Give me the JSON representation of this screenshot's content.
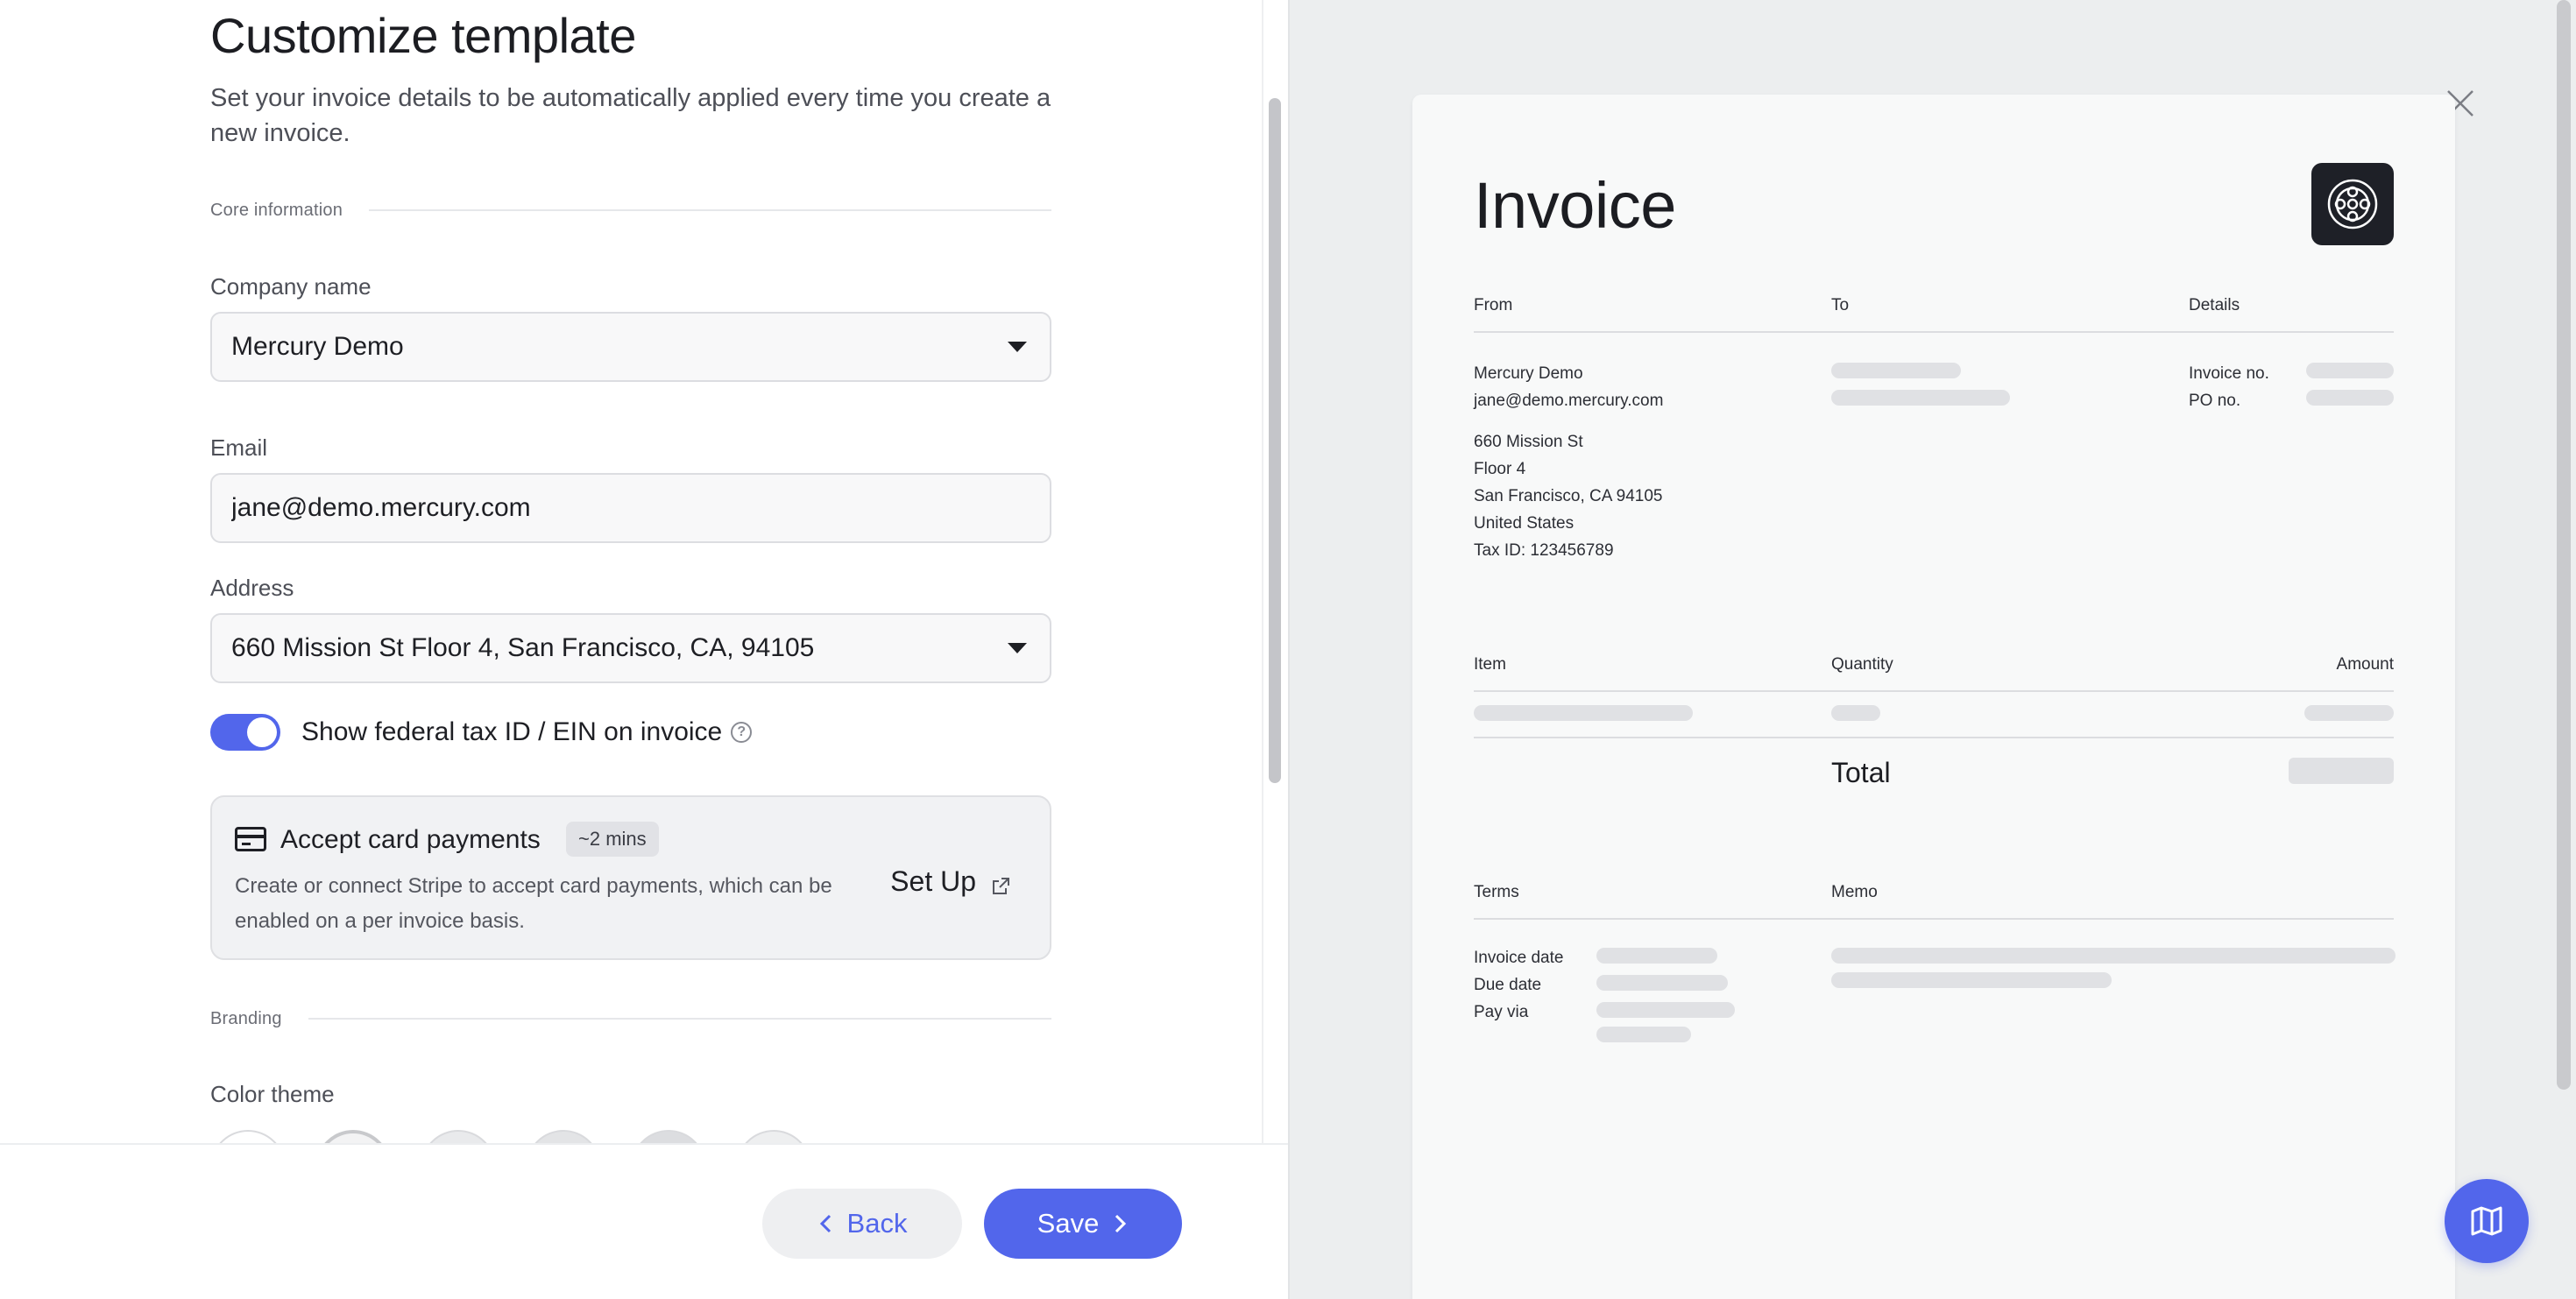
{
  "page": {
    "title": "Customize template",
    "description": "Set your invoice details to be automatically applied every time you create a new invoice."
  },
  "sections": {
    "core": "Core information",
    "branding": "Branding"
  },
  "fields": {
    "company_label": "Company name",
    "company_value": "Mercury Demo",
    "email_label": "Email",
    "email_value": "jane@demo.mercury.com",
    "address_label": "Address",
    "address_value": "660 Mission St Floor 4, San Francisco, CA, 94105"
  },
  "toggle": {
    "label": "Show federal tax ID / EIN on invoice",
    "on": true,
    "help_icon": "?"
  },
  "card_payments": {
    "title": "Accept card payments",
    "badge": "~2 mins",
    "description": "Create or connect Stripe to accept card payments, which can be enabled on a per invoice basis.",
    "setup_label": "Set Up"
  },
  "color_theme": {
    "label": "Color theme"
  },
  "footer": {
    "back_label": "Back",
    "save_label": "Save"
  },
  "invoice": {
    "title": "Invoice",
    "headers": {
      "from": "From",
      "to": "To",
      "details": "Details"
    },
    "from_lines": {
      "name": "Mercury Demo",
      "email": "jane@demo.mercury.com",
      "street": "660 Mission St",
      "floor": "Floor 4",
      "city": "San Francisco, CA 94105",
      "country": "United States",
      "tax": "Tax ID: 123456789"
    },
    "details": {
      "invoice_no": "Invoice no.",
      "po_no": "PO no."
    },
    "items": {
      "item": "Item",
      "quantity": "Quantity",
      "amount": "Amount",
      "total": "Total"
    },
    "bottom": {
      "terms": "Terms",
      "memo": "Memo",
      "invoice_date": "Invoice date",
      "due_date": "Due date",
      "pay_via": "Pay via"
    }
  },
  "colors": {
    "accent": "#5266eb",
    "logo_bg": "#1e2027"
  }
}
